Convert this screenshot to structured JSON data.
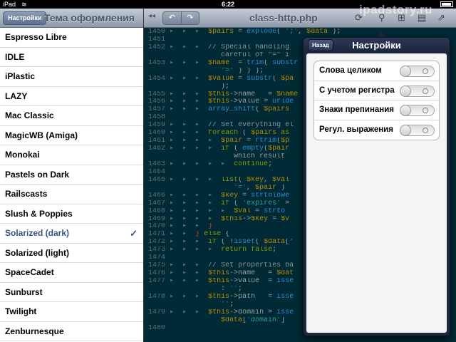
{
  "statusbar": {
    "carrier": "iPad",
    "time": "6:22"
  },
  "watermark": "ipadstory.ru",
  "sidebar": {
    "back_label": "Настройки",
    "title": "Тема оформления",
    "themes": [
      "Espresso Libre",
      "IDLE",
      "iPlastic",
      "LAZY",
      "Mac Classic",
      "MagicWB (Amiga)",
      "Monokai",
      "Pastels on Dark",
      "Railscasts",
      "Slush & Poppies",
      "Solarized (dark)",
      "Solarized (light)",
      "SpaceCadet",
      "Sunburst",
      "Twilight",
      "Zenburnesque"
    ],
    "selected": "Solarized (dark)"
  },
  "editor": {
    "title": "class-http.php",
    "collapse_symbol": "◂◂",
    "undo_symbol": "↶",
    "redo_symbol": "↷",
    "toolbar_icons": [
      "search-icon",
      "hierarchy-icon",
      "document-icon",
      "share-icon"
    ],
    "line_numbers": [
      "1450",
      "1451",
      "1452",
      "",
      "1453",
      "",
      "1454",
      "",
      "1455",
      "1456",
      "1457",
      "1458",
      "1459",
      "1460",
      "1461",
      "1462",
      "",
      "1463",
      "1464",
      "1465",
      "",
      "1466",
      "1467",
      "1468",
      "1469",
      "1470",
      "1471",
      "1472",
      "1473",
      "1474",
      "1475",
      "1476",
      "1477",
      "",
      "1478",
      "",
      "1479",
      "",
      "1480"
    ],
    "lines": [
      [
        [
          "gut",
          "▸  ▸  ▸  "
        ],
        [
          "tk-v",
          "$pairs"
        ],
        [
          "tk-o",
          " = "
        ],
        [
          "tk-f",
          "explode"
        ],
        [
          "tk-o",
          "( "
        ],
        [
          "tk-s",
          "';'"
        ],
        [
          "tk-o",
          ", "
        ],
        [
          "tk-v",
          "$data"
        ],
        [
          "tk-o",
          " );"
        ]
      ],
      [],
      [
        [
          "gut",
          "▸  ▸  ▸  "
        ],
        [
          "tk-c",
          "// Special handling"
        ]
      ],
      [
        [
          "gut",
          "            "
        ],
        [
          "tk-c",
          "careful of \"=\" i"
        ]
      ],
      [
        [
          "gut",
          "▸  ▸  ▸  "
        ],
        [
          "tk-v",
          "$name"
        ],
        [
          "tk-o",
          "  = "
        ],
        [
          "tk-f",
          "trim"
        ],
        [
          "tk-o",
          "( "
        ],
        [
          "tk-f",
          "substr"
        ]
      ],
      [
        [
          "gut",
          "            "
        ],
        [
          "tk-s",
          "'='"
        ],
        [
          "tk-o",
          " ) ) );"
        ]
      ],
      [
        [
          "gut",
          "▸  ▸  ▸  "
        ],
        [
          "tk-v",
          "$value"
        ],
        [
          "tk-o",
          " = "
        ],
        [
          "tk-f",
          "substr"
        ],
        [
          "tk-o",
          "( "
        ],
        [
          "tk-v",
          "$pa"
        ]
      ],
      [
        [
          "gut",
          "            "
        ],
        [
          "tk-o",
          ");"
        ]
      ],
      [
        [
          "gut",
          "▸  ▸  ▸  "
        ],
        [
          "tk-v",
          "$this"
        ],
        [
          "tk-o",
          "->name   = "
        ],
        [
          "tk-v",
          "$name"
        ]
      ],
      [
        [
          "gut",
          "▸  ▸  ▸  "
        ],
        [
          "tk-v",
          "$this"
        ],
        [
          "tk-o",
          "->value = "
        ],
        [
          "tk-f",
          "urlde"
        ]
      ],
      [
        [
          "gut",
          "▸  ▸  ▸  "
        ],
        [
          "tk-f",
          "array_shift"
        ],
        [
          "tk-o",
          "( "
        ],
        [
          "tk-v",
          "$pairs"
        ]
      ],
      [],
      [
        [
          "gut",
          "▸  ▸  ▸  "
        ],
        [
          "tk-c",
          "// Set everything el"
        ]
      ],
      [
        [
          "gut",
          "▸  ▸  ▸  "
        ],
        [
          "tk-k",
          "foreach"
        ],
        [
          "tk-o",
          " ( "
        ],
        [
          "tk-v",
          "$pairs"
        ],
        [
          "tk-k",
          " as"
        ]
      ],
      [
        [
          "gut",
          "▸  ▸  ▸  ▸  "
        ],
        [
          "tk-v",
          "$pair"
        ],
        [
          "tk-o",
          " = "
        ],
        [
          "tk-f",
          "rtrim"
        ],
        [
          "tk-o",
          "("
        ],
        [
          "tk-v",
          "$p"
        ]
      ],
      [
        [
          "gut",
          "▸  ▸  ▸  ▸  "
        ],
        [
          "tk-k",
          "if"
        ],
        [
          "tk-o",
          " ( "
        ],
        [
          "tk-f",
          "empty"
        ],
        [
          "tk-o",
          "("
        ],
        [
          "tk-v",
          "$pair"
        ]
      ],
      [
        [
          "gut",
          "               "
        ],
        [
          "tk-o",
          "which result"
        ]
      ],
      [
        [
          "gut",
          "▸  ▸  ▸  ▸  ▸  "
        ],
        [
          "tk-k",
          "continue"
        ],
        [
          "tk-o",
          ";"
        ]
      ],
      [],
      [
        [
          "gut",
          "▸  ▸  ▸  ▸  "
        ],
        [
          "tk-k",
          "list"
        ],
        [
          "tk-o",
          "( "
        ],
        [
          "tk-v",
          "$key"
        ],
        [
          "tk-o",
          ", "
        ],
        [
          "tk-v",
          "$val"
        ]
      ],
      [
        [
          "gut",
          "               "
        ],
        [
          "tk-s",
          "'='"
        ],
        [
          "tk-o",
          ", "
        ],
        [
          "tk-v",
          "$pair"
        ],
        [
          "tk-o",
          " )"
        ]
      ],
      [
        [
          "gut",
          "▸  ▸  ▸  ▸  "
        ],
        [
          "tk-v",
          "$key"
        ],
        [
          "tk-o",
          " = "
        ],
        [
          "tk-f",
          "strtolowe"
        ]
      ],
      [
        [
          "gut",
          "▸  ▸  ▸  ▸  "
        ],
        [
          "tk-k",
          "if"
        ],
        [
          "tk-o",
          " ( "
        ],
        [
          "tk-s",
          "'expires'"
        ],
        [
          "tk-o",
          " ="
        ]
      ],
      [
        [
          "gut",
          "▸  ▸  ▸  ▸  ▸  "
        ],
        [
          "tk-v",
          "$val"
        ],
        [
          "tk-o",
          " = "
        ],
        [
          "tk-f",
          "strto"
        ]
      ],
      [
        [
          "gut",
          "▸  ▸  ▸  ▸  "
        ],
        [
          "tk-v",
          "$this"
        ],
        [
          "tk-o",
          "->"
        ],
        [
          "tk-v",
          "$key"
        ],
        [
          "tk-o",
          " = "
        ],
        [
          "tk-v",
          "$v"
        ]
      ],
      [
        [
          "gut",
          "▸  ▸  ▸  "
        ],
        [
          "tk-r",
          "}"
        ]
      ],
      [
        [
          "gut",
          "▸  ▸  "
        ],
        [
          "tk-r",
          "}"
        ],
        [
          "tk-k",
          " else"
        ],
        [
          "tk-o",
          " {"
        ]
      ],
      [
        [
          "gut",
          "▸  ▸  ▸  "
        ],
        [
          "tk-k",
          "if"
        ],
        [
          "tk-o",
          " ( !"
        ],
        [
          "tk-f",
          "isset"
        ],
        [
          "tk-o",
          "( "
        ],
        [
          "tk-v",
          "$data"
        ],
        [
          "tk-o",
          "['"
        ]
      ],
      [
        [
          "gut",
          "▸  ▸  ▸  ▸  "
        ],
        [
          "tk-k",
          "return"
        ],
        [
          "tk-k",
          " false"
        ],
        [
          "tk-o",
          ";"
        ]
      ],
      [],
      [
        [
          "gut",
          "▸  ▸  ▸  "
        ],
        [
          "tk-c",
          "// Set properties ba"
        ]
      ],
      [
        [
          "gut",
          "▸  ▸  ▸  "
        ],
        [
          "tk-v",
          "$this"
        ],
        [
          "tk-o",
          "->name   = "
        ],
        [
          "tk-v",
          "$dat"
        ]
      ],
      [
        [
          "gut",
          "▸  ▸  ▸  "
        ],
        [
          "tk-v",
          "$this"
        ],
        [
          "tk-o",
          "->value  = "
        ],
        [
          "tk-f",
          "isse"
        ]
      ],
      [
        [
          "gut",
          "            "
        ],
        [
          "tk-o",
          ": "
        ],
        [
          "tk-s",
          "''"
        ],
        [
          "tk-o",
          ";"
        ]
      ],
      [
        [
          "gut",
          "▸  ▸  ▸  "
        ],
        [
          "tk-v",
          "$this"
        ],
        [
          "tk-o",
          "->path   = "
        ],
        [
          "tk-f",
          "isse"
        ]
      ],
      [
        [
          "gut",
          "            "
        ],
        [
          "tk-s",
          "''"
        ],
        [
          "tk-o",
          ";"
        ]
      ],
      [
        [
          "gut",
          "▸  ▸  ▸  "
        ],
        [
          "tk-v",
          "$this"
        ],
        [
          "tk-o",
          "->domain = "
        ],
        [
          "tk-f",
          "isse"
        ]
      ],
      [
        [
          "gut",
          "            "
        ],
        [
          "tk-v",
          "$data"
        ],
        [
          "tk-o",
          "["
        ],
        [
          "tk-s",
          "'domain'"
        ],
        [
          "tk-o",
          "] "
        ]
      ],
      []
    ]
  },
  "popover": {
    "back_label": "Назад",
    "title": "Настройки",
    "options": [
      {
        "label": "Слова целиком",
        "on": false
      },
      {
        "label": "С учетом регистра",
        "on": false
      },
      {
        "label": "Знаки препинания",
        "on": false
      },
      {
        "label": "Регул. выражения",
        "on": false
      }
    ]
  }
}
